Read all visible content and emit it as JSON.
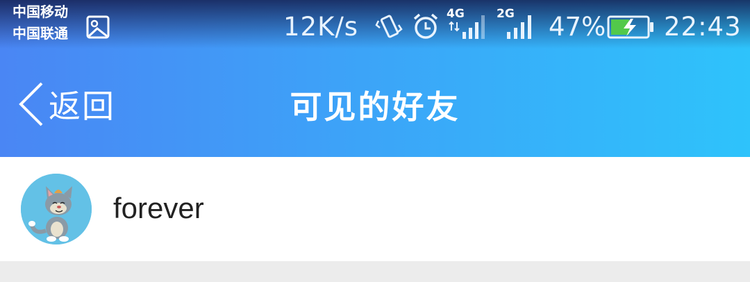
{
  "status_bar": {
    "carrier_1": "中国移动",
    "carrier_2": "中国联通",
    "net_speed": "12K/s",
    "sim1_network": "4G",
    "sim2_network": "2G",
    "battery_percent": "47%",
    "time": "22:43",
    "icons": [
      "image-icon",
      "vibrate-icon",
      "alarm-icon",
      "signal-icon",
      "battery-charging-icon"
    ]
  },
  "nav": {
    "back_label": "返回",
    "title": "可见的好友"
  },
  "friends": [
    {
      "name": "forever",
      "avatar": "cartoon-cat-avatar"
    }
  ],
  "colors": {
    "header_start": "#4a86f4",
    "header_end": "#2ec3fb",
    "list_bg": "#ffffff",
    "page_bg": "#ececec",
    "name_text": "#222222"
  }
}
